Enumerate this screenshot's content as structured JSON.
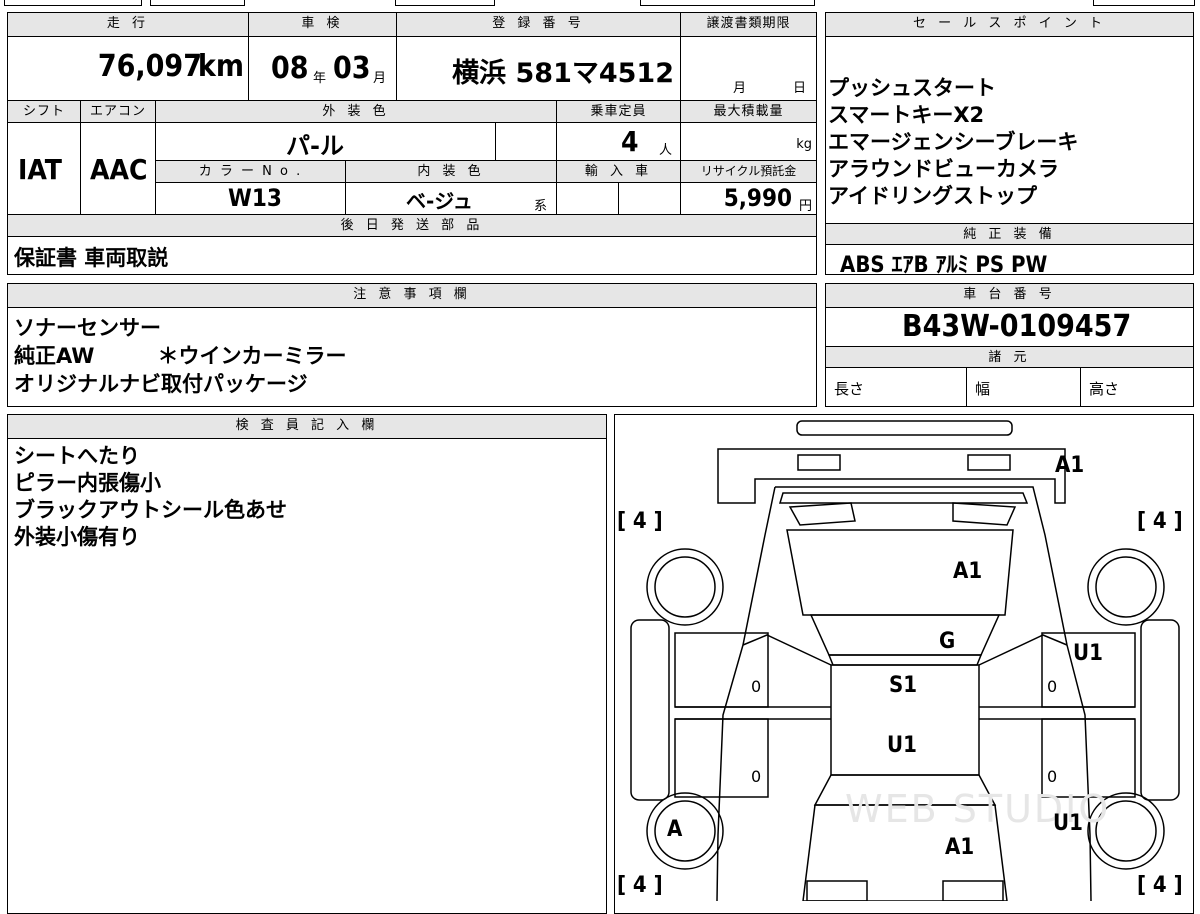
{
  "top": {
    "headers": {
      "mileage": "走 行",
      "inspection": "車 検",
      "registration": "登 録 番 号",
      "transfer_deadline": "譲渡書類期限"
    },
    "mileage_value": "76,097",
    "mileage_unit": "km",
    "inspection_year": "08",
    "inspection_year_unit": "年",
    "inspection_month": "03",
    "inspection_month_unit": "月",
    "registration_number": "横浜 581マ4512",
    "transfer_month": "月",
    "transfer_day": "日"
  },
  "row2": {
    "headers": {
      "shift": "シフト",
      "aircon": "エアコン",
      "exterior_color": "外 装 色",
      "capacity": "乗車定員",
      "max_load": "最大積載量"
    },
    "shift": "IAT",
    "aircon": "AAC",
    "exterior_color": "パ-ル",
    "capacity": "4",
    "capacity_unit": "人",
    "max_load_unit": "kg",
    "headers2": {
      "color_no": "カ ラ ー N o .",
      "interior_color": "内 装 色",
      "import": "輸 入 車",
      "recycle": "リサイクル預託金"
    },
    "color_no": "W13",
    "interior_color": "ベ-ジュ",
    "interior_suffix": "系",
    "recycle_fee": "5,990",
    "recycle_unit": "円"
  },
  "later_parts": {
    "header": "後 日 発 送 部 品",
    "value": "保証書 車両取説"
  },
  "sales_points": {
    "header": "セ ー ル ス ポ イ ン ト",
    "items": [
      "プッシュスタート",
      "スマートキーX2",
      "エマージェンシーブレーキ",
      "アラウンドビューカメラ",
      "アイドリングストップ"
    ]
  },
  "equipment": {
    "header": "純 正 装 備",
    "value": "ABS ｴｱB ｱﾙﾐ PS PW"
  },
  "notes": {
    "header": "注 意 事 項 欄",
    "lines": [
      "ソナーセンサー",
      "純正AW　　　＊ウインカーミラー",
      "オリジナルナビ取付パッケージ"
    ]
  },
  "chassis": {
    "header": "車 台 番 号",
    "value": "B43W-0109457"
  },
  "specs": {
    "header": "諸 元",
    "length": "長さ",
    "width": "幅",
    "height": "高さ"
  },
  "inspector": {
    "header": "検 査 員 記 入 欄",
    "lines": [
      "シートへたり",
      "ピラー内張傷小",
      "ブラックアウトシール色あせ",
      "外装小傷有り"
    ]
  },
  "diagram": {
    "tire_marks": [
      "[ 4 ]",
      "[ 4 ]",
      "[ 4 ]",
      "[ 4 ]"
    ],
    "marks": {
      "rear_bumper": "A1",
      "roof_front": "A1",
      "windshield": "G",
      "right_front_door": "U1",
      "roof": "S1",
      "roof_rear": "U1",
      "right_rear_door": "U1",
      "hood": "A1",
      "left_wheel": "A"
    },
    "zero": "0",
    "watermark": "WEB STUDIO"
  }
}
